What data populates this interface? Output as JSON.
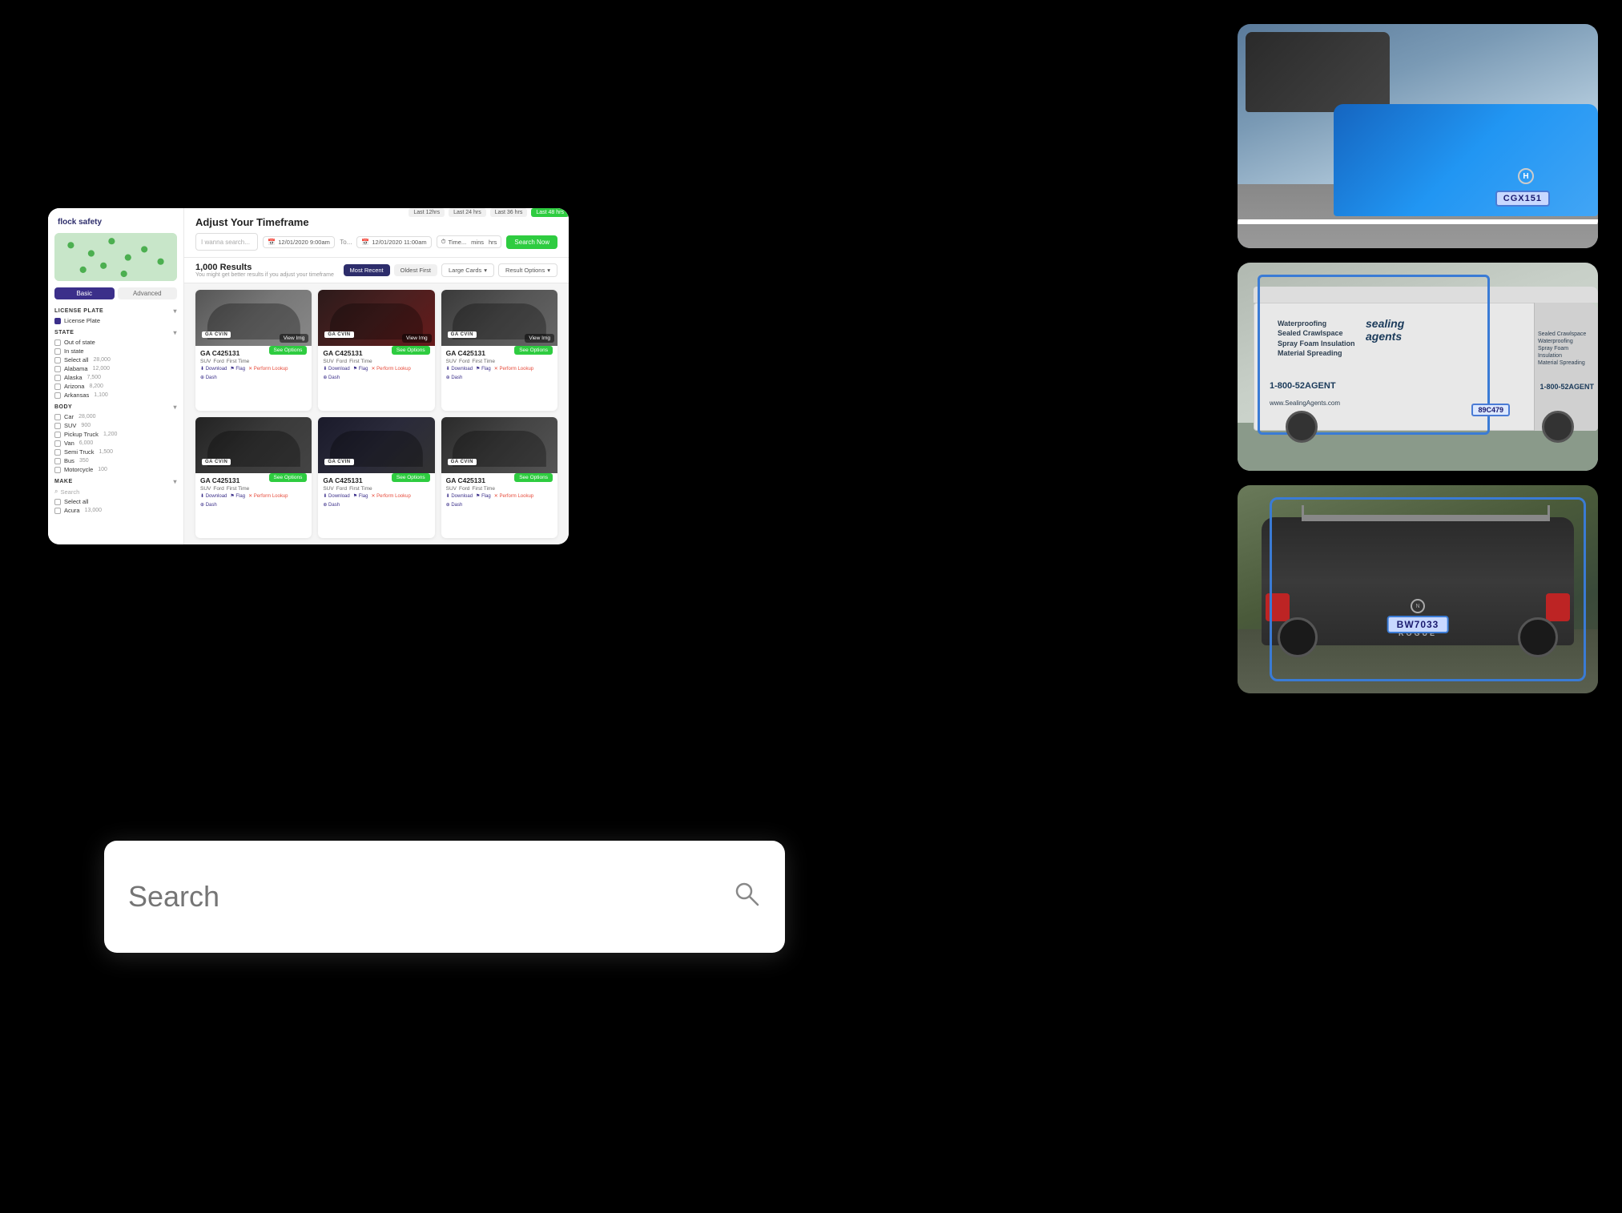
{
  "app": {
    "logo": "flock safety",
    "title": "Adjust Your Timeframe",
    "tabs": {
      "basic": "Basic",
      "advanced": "Advanced"
    },
    "timeframes": [
      {
        "label": "Last 12hrs",
        "active": false
      },
      {
        "label": "Last 24 hrs",
        "active": false
      },
      {
        "label": "Last 36 hrs",
        "active": false
      },
      {
        "label": "Last 48 hrs",
        "active": true
      }
    ],
    "search": {
      "placeholder": "I wanna search...",
      "date_from": "12/01/2020 9:00am",
      "to_label": "To...",
      "date_to": "12/01/2020 11:00am",
      "time_placeholder": "Time...",
      "mins": "mins",
      "hrs": "hrs",
      "search_btn": "Search Now"
    },
    "results": {
      "count": "1,000 Results",
      "hint": "You might get better results if you adjust your timeframe",
      "sort_most_recent": "Most Recent",
      "sort_oldest_first": "Oldest First",
      "view_dropdown": "Large Cards",
      "options_dropdown": "Result Options"
    },
    "sidebar": {
      "section_license": "LICENSE PLATE",
      "license_checkbox_label": "License Plate",
      "section_state": "STATE",
      "states": [
        {
          "label": "Out of state",
          "count": "",
          "checked": false
        },
        {
          "label": "In state",
          "count": "",
          "checked": false
        },
        {
          "label": "Select all",
          "count": "28,000",
          "checked": false
        },
        {
          "label": "Alabama",
          "count": "12,000",
          "checked": false
        },
        {
          "label": "Alaska",
          "count": "7,500",
          "checked": false
        },
        {
          "label": "Arizona",
          "count": "8,200",
          "checked": false
        },
        {
          "label": "Arkansas",
          "count": "1,100",
          "checked": false
        }
      ],
      "section_body": "BODY",
      "body_types": [
        {
          "label": "Car",
          "count": "28,000"
        },
        {
          "label": "SUV",
          "count": "900"
        },
        {
          "label": "Pickup Truck",
          "count": "1,200"
        },
        {
          "label": "Van",
          "count": "6,000"
        },
        {
          "label": "Semi Truck",
          "count": "1,500"
        },
        {
          "label": "Bus",
          "count": "350"
        },
        {
          "label": "Motorcycle",
          "count": "100"
        }
      ],
      "section_make": "MAKE",
      "make_search": "Search",
      "makes": [
        {
          "label": "Select all",
          "count": ""
        },
        {
          "label": "Acura",
          "count": "13,000"
        }
      ]
    },
    "cards": [
      {
        "plate": "GA C425131",
        "see_btn": "See Options",
        "tags": [
          "SUV",
          "Ford",
          "First Time"
        ],
        "actions": [
          "Download",
          "Flag",
          "Perform Lookup",
          "Dash"
        ]
      },
      {
        "plate": "GA C425131",
        "see_btn": "See Options",
        "tags": [
          "SUV",
          "Ford",
          "First Time"
        ],
        "actions": [
          "Download",
          "Flag",
          "Perform Lookup",
          "Dash"
        ]
      },
      {
        "plate": "GA C425131",
        "see_btn": "See Options",
        "tags": [
          "SUV",
          "Ford",
          "First Time"
        ],
        "actions": [
          "Download",
          "Flag",
          "Perform Lookup",
          "Dash"
        ]
      },
      {
        "plate": "GA C425131",
        "see_btn": "See Options",
        "tags": [
          "SUV",
          "Ford",
          "First Time"
        ],
        "actions": [
          "Download",
          "Flag",
          "Perform Lookup",
          "Dash"
        ]
      },
      {
        "plate": "GA C425131",
        "see_btn": "See Options",
        "tags": [
          "SUV",
          "Ford",
          "First Time"
        ],
        "actions": [
          "Download",
          "Flag",
          "Perform Lookup",
          "Dash"
        ]
      },
      {
        "plate": "GA C425131",
        "see_btn": "See Options",
        "tags": [
          "SUV",
          "Ford",
          "First Time"
        ],
        "actions": [
          "Download",
          "Flag",
          "Perform Lookup",
          "Dash"
        ]
      }
    ]
  },
  "search_box": {
    "placeholder": "Search",
    "icon": "🔍"
  },
  "car_images": {
    "image1": {
      "alt": "Blue Honda rear with license plate CGX151",
      "plate": "CGX151"
    },
    "image2": {
      "alt": "White Sealing Agents van with highlighted license plate",
      "company": "sealing agents",
      "plate": "89C479",
      "phone": "1-800-52AGENT"
    },
    "image3": {
      "alt": "Dark Nissan Rogue rear with license plate BW7033",
      "plate": "BW7033",
      "model": "ROGUE"
    }
  },
  "colors": {
    "accent_green": "#2ecc40",
    "accent_purple": "#3b2f8a",
    "plate_blue": "#3a7bd5"
  }
}
